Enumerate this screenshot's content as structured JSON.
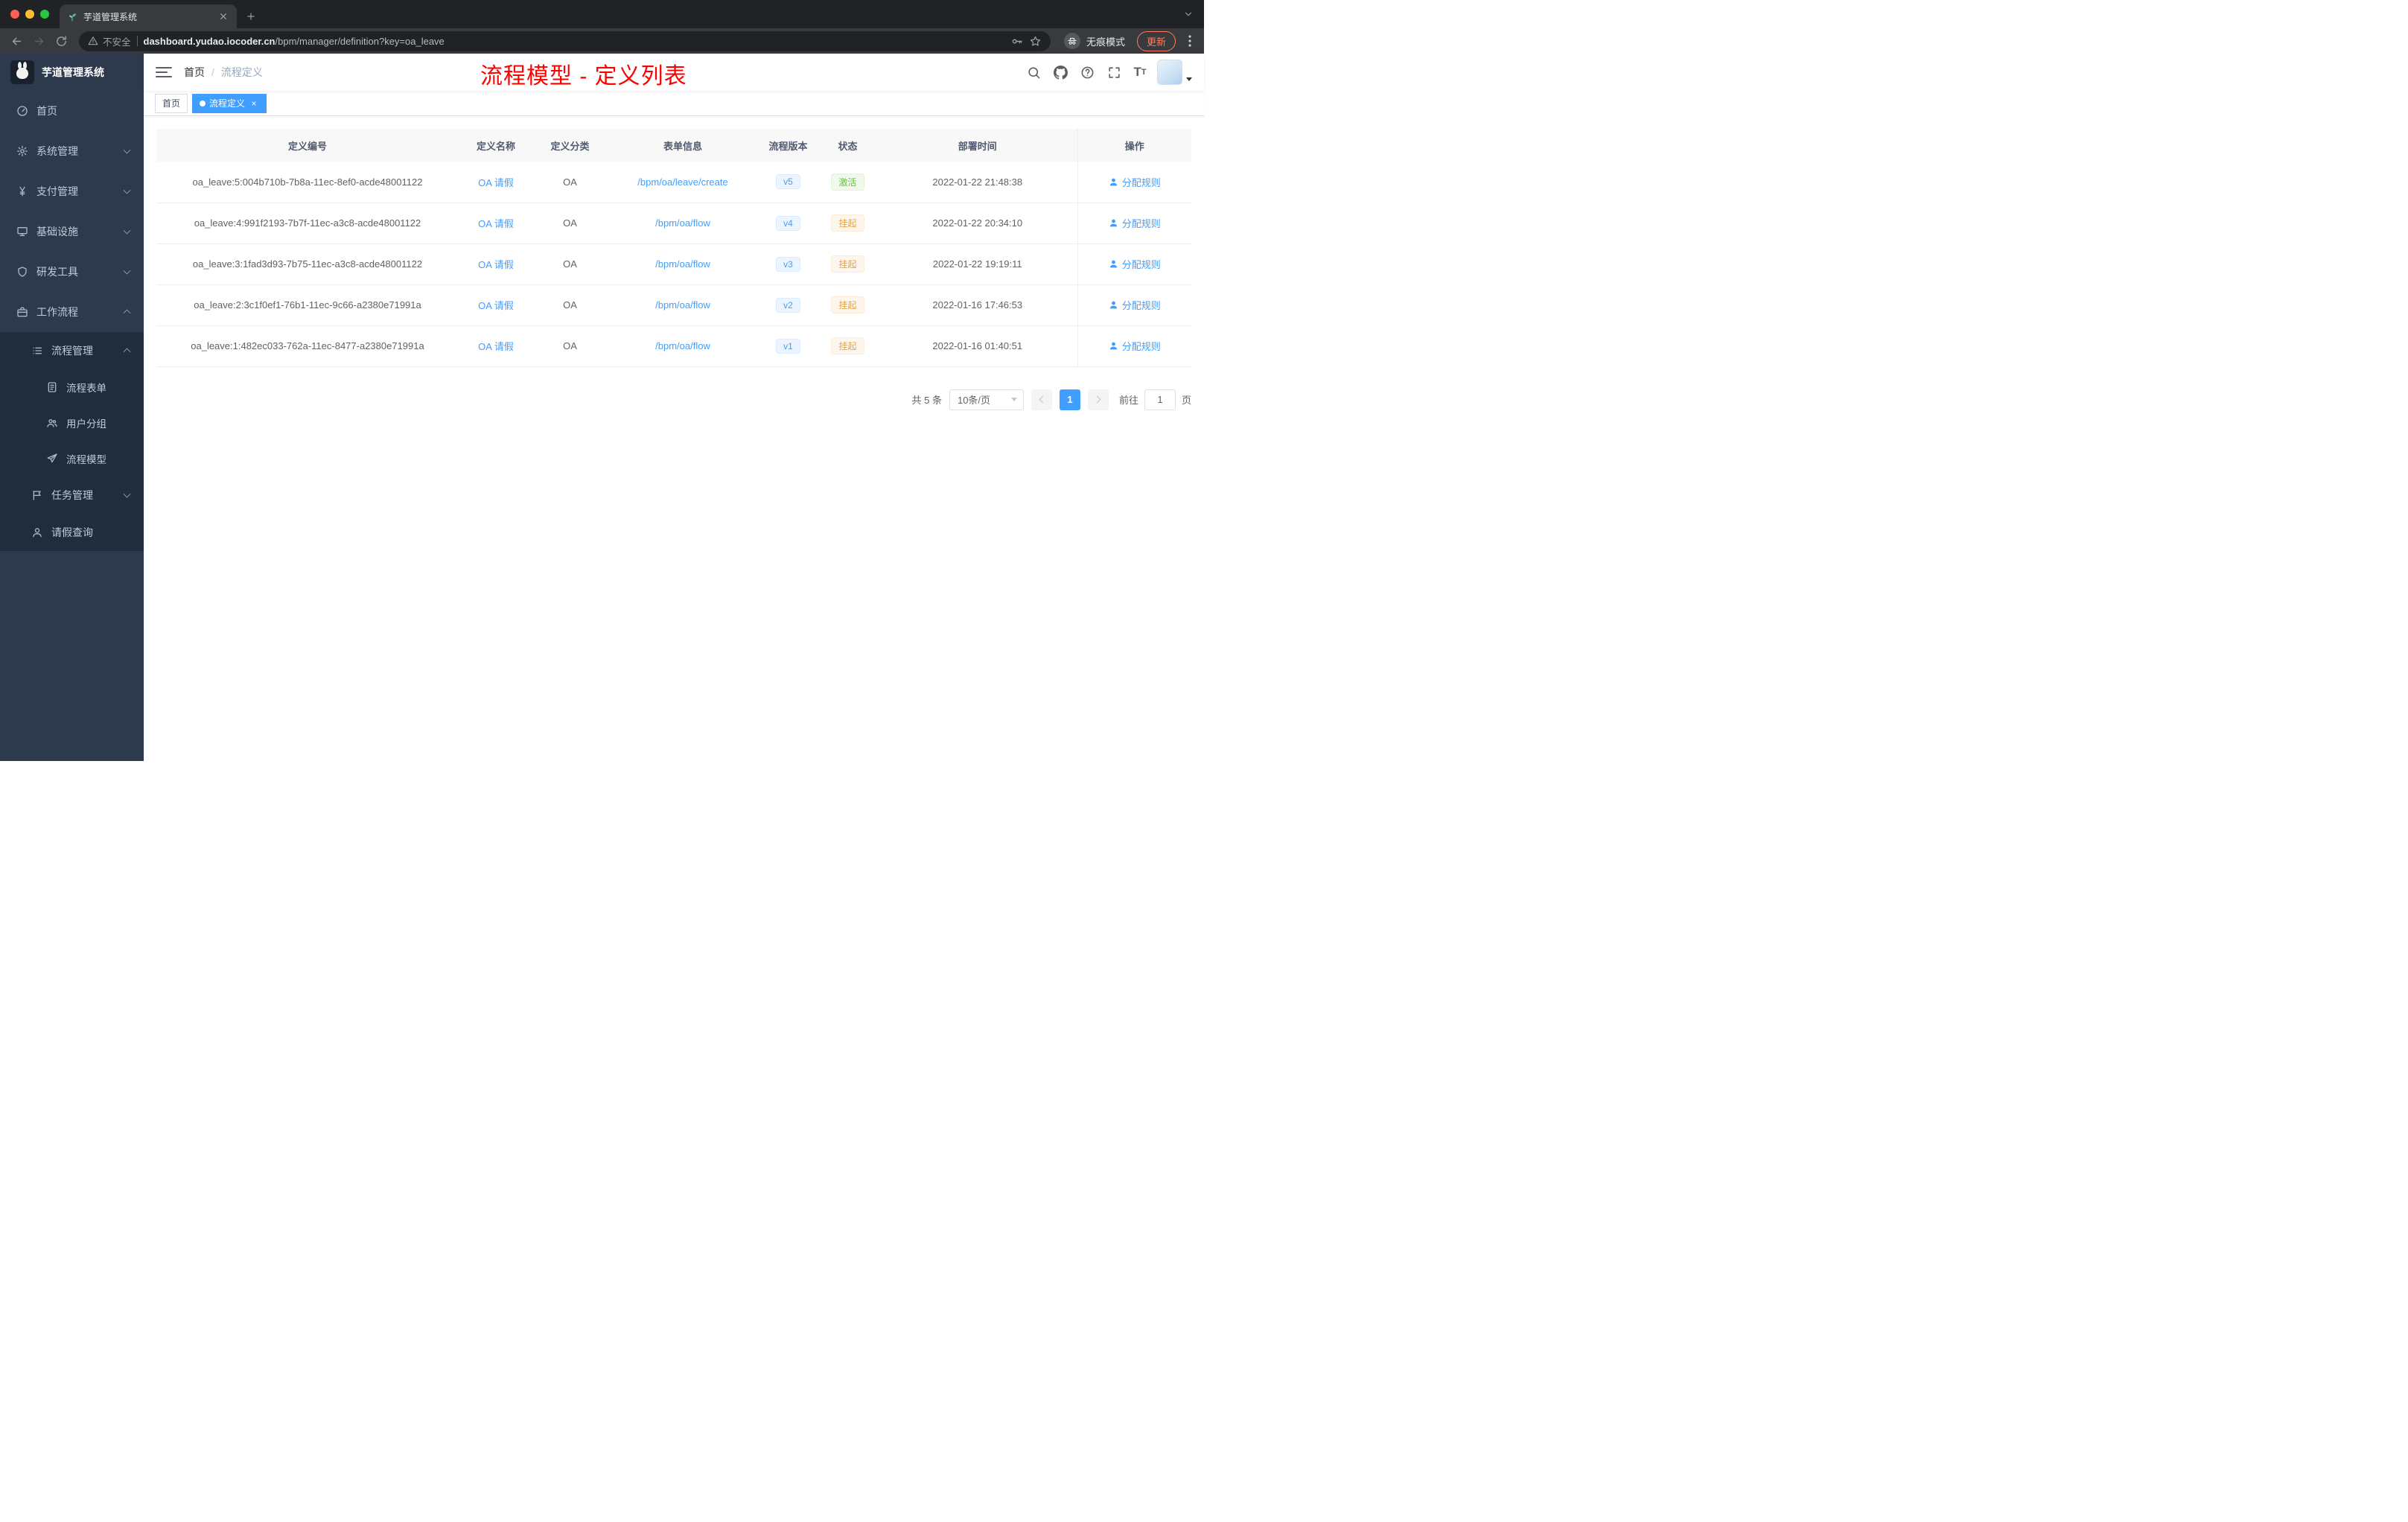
{
  "colors": {
    "accent": "#409eff",
    "success": "#67c23a",
    "warning": "#e6a23c",
    "annotation_red": "#fe0000",
    "sidebar_bg": "#2d3a4d"
  },
  "browser": {
    "tab_title": "芋道管理系统",
    "insecure_label": "不安全",
    "url_domain": "dashboard.yudao.iocoder.cn",
    "url_path": "/bpm/manager/definition?key=oa_leave",
    "incognito_label": "无痕模式",
    "update_label": "更新"
  },
  "sidebar": {
    "app_title": "芋道管理系统",
    "menu": [
      {
        "key": "home",
        "label": "首页",
        "icon": "home-icon"
      },
      {
        "key": "system",
        "label": "系统管理",
        "icon": "gear-icon",
        "expandable": true
      },
      {
        "key": "payment",
        "label": "支付管理",
        "icon": "yen-icon",
        "expandable": true
      },
      {
        "key": "infra",
        "label": "基础设施",
        "icon": "infra-icon",
        "expandable": true
      },
      {
        "key": "devtools",
        "label": "研发工具",
        "icon": "tools-icon",
        "expandable": true
      },
      {
        "key": "workflow",
        "label": "工作流程",
        "icon": "workflow-icon",
        "expandable": true,
        "expanded": true,
        "children": [
          {
            "key": "process-mgmt",
            "label": "流程管理",
            "icon": "process-icon",
            "expandable": true,
            "expanded": true,
            "children": [
              {
                "key": "process-form",
                "label": "流程表单",
                "icon": "form-icon"
              },
              {
                "key": "user-group",
                "label": "用户分组",
                "icon": "group-icon"
              },
              {
                "key": "process-model",
                "label": "流程模型",
                "icon": "model-icon"
              }
            ]
          },
          {
            "key": "task-mgmt",
            "label": "任务管理",
            "icon": "task-icon",
            "expandable": true
          },
          {
            "key": "leave-query",
            "label": "请假查询",
            "icon": "person-icon"
          }
        ]
      }
    ]
  },
  "header": {
    "breadcrumb": [
      "首页",
      "流程定义"
    ],
    "annotation": "流程模型 - 定义列表",
    "icons": [
      "search-icon",
      "github-icon",
      "question-icon",
      "fullscreen-icon",
      "fontsize-icon"
    ]
  },
  "tags": [
    {
      "label": "首页",
      "active": false,
      "closable": false
    },
    {
      "label": "流程定义",
      "active": true,
      "closable": true
    }
  ],
  "table": {
    "columns": [
      "定义编号",
      "定义名称",
      "定义分类",
      "表单信息",
      "流程版本",
      "状态",
      "部署时间",
      "操作"
    ],
    "rows": [
      {
        "id": "oa_leave:5:004b710b-7b8a-11ec-8ef0-acde48001122",
        "name": "OA 请假",
        "category": "OA",
        "form": "/bpm/oa/leave/create",
        "version": "v5",
        "status": "激活",
        "status_type": "success",
        "time": "2022-01-22 21:48:38",
        "action": "分配规则"
      },
      {
        "id": "oa_leave:4:991f2193-7b7f-11ec-a3c8-acde48001122",
        "name": "OA 请假",
        "category": "OA",
        "form": "/bpm/oa/flow",
        "version": "v4",
        "status": "挂起",
        "status_type": "warning",
        "time": "2022-01-22 20:34:10",
        "action": "分配规则"
      },
      {
        "id": "oa_leave:3:1fad3d93-7b75-11ec-a3c8-acde48001122",
        "name": "OA 请假",
        "category": "OA",
        "form": "/bpm/oa/flow",
        "version": "v3",
        "status": "挂起",
        "status_type": "warning",
        "time": "2022-01-22 19:19:11",
        "action": "分配规则"
      },
      {
        "id": "oa_leave:2:3c1f0ef1-76b1-11ec-9c66-a2380e71991a",
        "name": "OA 请假",
        "category": "OA",
        "form": "/bpm/oa/flow",
        "version": "v2",
        "status": "挂起",
        "status_type": "warning",
        "time": "2022-01-16 17:46:53",
        "action": "分配规则"
      },
      {
        "id": "oa_leave:1:482ec033-762a-11ec-8477-a2380e71991a",
        "name": "OA 请假",
        "category": "OA",
        "form": "/bpm/oa/flow",
        "version": "v1",
        "status": "挂起",
        "status_type": "warning",
        "time": "2022-01-16 01:40:51",
        "action": "分配规则"
      }
    ]
  },
  "pagination": {
    "total_label": "共 5 条",
    "page_size": "10条/页",
    "current_page": "1",
    "goto_label": "前往",
    "goto_value": "1",
    "page_unit": "页"
  }
}
